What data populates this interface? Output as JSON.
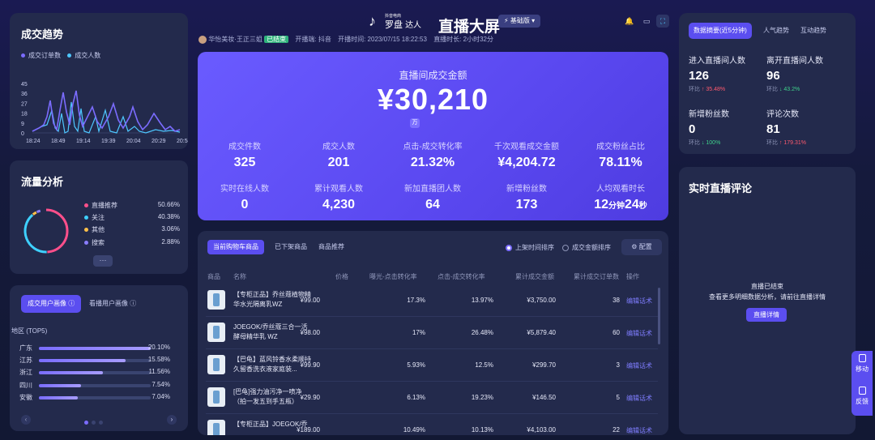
{
  "trend": {
    "title": "成交趋势",
    "legend": [
      "成交订单数",
      "成交人数"
    ],
    "y_ticks": [
      "45",
      "36",
      "27",
      "18",
      "9",
      "0"
    ],
    "x_ticks": [
      "18:24",
      "18:49",
      "19:14",
      "19:39",
      "20:04",
      "20:29",
      "20:54"
    ],
    "colors": {
      "orders": "#7b6cff",
      "people": "#4ec7ff"
    }
  },
  "traffic": {
    "title": "流量分析",
    "items": [
      {
        "label": "直播推荐",
        "value": "50.66%",
        "color": "#ff4f8b",
        "fraction": 0.5066
      },
      {
        "label": "关注",
        "value": "40.38%",
        "color": "#3ed0ff",
        "fraction": 0.4038
      },
      {
        "label": "其他",
        "value": "3.06%",
        "color": "#ffc14a",
        "fraction": 0.0306
      },
      {
        "label": "搜索",
        "value": "2.88%",
        "color": "#8a7dff",
        "fraction": 0.0288
      }
    ],
    "more": "···"
  },
  "users": {
    "tabs": [
      "成交用户画像",
      "看播用户画像"
    ],
    "region_title": "地区 (TOP5)",
    "regions": [
      {
        "name": "广东",
        "value": "20.10%",
        "fraction": 0.201
      },
      {
        "name": "江苏",
        "value": "15.58%",
        "fraction": 0.1558
      },
      {
        "name": "浙江",
        "value": "11.56%",
        "fraction": 0.1156
      },
      {
        "name": "四川",
        "value": "7.54%",
        "fraction": 0.0754
      },
      {
        "name": "安徽",
        "value": "7.04%",
        "fraction": 0.0704
      }
    ]
  },
  "header": {
    "brand_small": "抖音电商",
    "brand_name": "罗盘",
    "brand_role": "达人",
    "title": "直播大屏",
    "version": "基础版",
    "anchor": "华怡美妆·王正三姐",
    "status": "已结束",
    "channel_label": "开播端:",
    "channel": "抖音",
    "start_label": "开播时间:",
    "start_time": "2023/07/15 18:22:53",
    "duration_label": "直播时长:",
    "duration": "2小时32分"
  },
  "hero": {
    "title": "直播间成交金额",
    "amount": "¥30,210",
    "unit": "万",
    "metrics": [
      {
        "label": "成交件数",
        "value": "325"
      },
      {
        "label": "成交人数",
        "value": "201"
      },
      {
        "label": "点击-成交转化率",
        "value": "21.32%"
      },
      {
        "label": "千次观看成交金额",
        "value": "¥4,204.72"
      },
      {
        "label": "成交粉丝占比",
        "value": "78.11%"
      },
      {
        "label": "实时在线人数",
        "value": "0"
      },
      {
        "label": "累计观看人数",
        "value": "4,230"
      },
      {
        "label": "新加直播团人数",
        "value": "64"
      },
      {
        "label": "新增粉丝数",
        "value": "173"
      },
      {
        "label": "人均观看时长",
        "value_num1": "12",
        "value_unit1": "分钟",
        "value_num2": "24",
        "value_unit2": "秒"
      }
    ]
  },
  "products": {
    "tabs": [
      "当前购物车商品",
      "已下架商品",
      "商品推荐"
    ],
    "sort_options": [
      "上架时间排序",
      "成交金额排序"
    ],
    "config": "配置",
    "columns": [
      "商品",
      "名称",
      "价格",
      "曝光-点击转化率",
      "点击-成交转化率",
      "累计成交金额",
      "累计成交订单数",
      "操作"
    ],
    "rows": [
      {
        "name": "【专柜正品】乔丝蔻植物精华水光隔离乳WZ",
        "price": "¥99.00",
        "ctr": "17.3%",
        "cvr": "13.97%",
        "gmv": "¥3,750.00",
        "orders": "38",
        "action": "编辑话术"
      },
      {
        "name": "JOEGOK/乔丝蔻三合一活酵母精华乳 WZ",
        "price": "¥98.00",
        "ctr": "17%",
        "cvr": "26.48%",
        "gmv": "¥5,879.40",
        "orders": "60",
        "action": "编辑话术"
      },
      {
        "name": "【巴龟】蓝风铃香水柔顺持久留香洗衣液家庭装...",
        "price": "¥99.90",
        "ctr": "5.93%",
        "cvr": "12.5%",
        "gmv": "¥299.70",
        "orders": "3",
        "action": "编辑话术"
      },
      {
        "name": "[巴龟]强力油污净一喷净（拍一发五到手五瓶）",
        "price": "¥29.90",
        "ctr": "6.13%",
        "cvr": "19.23%",
        "gmv": "¥146.50",
        "orders": "5",
        "action": "编辑话术"
      },
      {
        "name": "【专柜正品】JOEGOK/乔",
        "price": "¥189.00",
        "ctr": "10.49%",
        "cvr": "10.13%",
        "gmv": "¥4,103.00",
        "orders": "22",
        "action": "编辑话术"
      }
    ]
  },
  "rstats": {
    "tabs": [
      "数据摘要(近5分钟)",
      "人气趋势",
      "互动趋势"
    ],
    "items": [
      {
        "label": "进入直播间人数",
        "value": "126",
        "change_label": "环比",
        "change": "↑ 35.48%",
        "dir": "up"
      },
      {
        "label": "离开直播间人数",
        "value": "96",
        "change_label": "环比",
        "change": "↓ 43.2%",
        "dir": "down"
      },
      {
        "label": "新增粉丝数",
        "value": "0",
        "change_label": "环比",
        "change": "↓ 100%",
        "dir": "down"
      },
      {
        "label": "评论次数",
        "value": "81",
        "change_label": "环比",
        "change": "↑ 179.31%",
        "dir": "up"
      }
    ]
  },
  "comments": {
    "title": "实时直播评论",
    "ended": "直播已结束",
    "hint": "查看更多明细数据分析，请前往直播详情",
    "button": "直播详情"
  },
  "side": {
    "move": "移动",
    "feedback": "反馈"
  }
}
